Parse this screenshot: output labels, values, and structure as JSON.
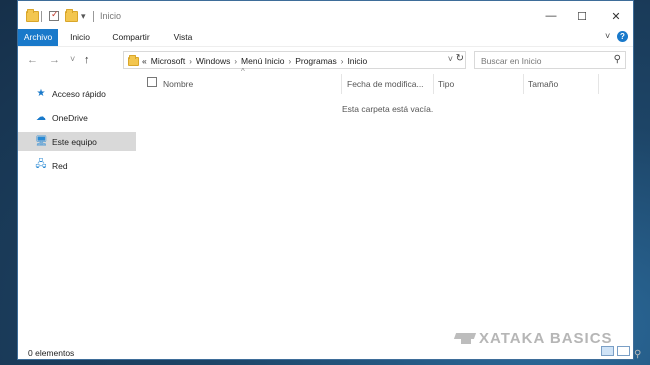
{
  "window": {
    "title": "Inicio",
    "minimize": "—",
    "maximize": "☐",
    "close": "✕"
  },
  "ribbon": {
    "tabs": [
      "Archivo",
      "Inicio",
      "Compartir",
      "Vista"
    ],
    "expand": "˅",
    "help": "?"
  },
  "address": {
    "overflow": "«",
    "crumbs": [
      "Microsoft",
      "Windows",
      "Menú Inicio",
      "Programas",
      "Inicio"
    ],
    "separator": "›",
    "dropdown": "˅",
    "refresh": "↻"
  },
  "search": {
    "placeholder": "Buscar en Inicio",
    "icon": "search-icon"
  },
  "nav_buttons": {
    "back": "←",
    "forward": "→",
    "recent": "˅",
    "up": "↑"
  },
  "navigation_pane": {
    "items": [
      {
        "label": "Acceso rápido",
        "icon": "star-icon",
        "glyph": "★",
        "color": "#1979ca"
      },
      {
        "label": "OneDrive",
        "icon": "cloud-icon",
        "glyph": "☁",
        "color": "#1979ca"
      },
      {
        "label": "Este equipo",
        "icon": "computer-icon",
        "glyph": "🖥",
        "color": "#2a8ad4",
        "selected": true
      },
      {
        "label": "Red",
        "icon": "network-icon",
        "glyph": "🖧",
        "color": "#2a8ad4"
      }
    ]
  },
  "columns": [
    "Nombre",
    "Fecha de modifica...",
    "Tipo",
    "Tamaño"
  ],
  "sort_indicator": "^",
  "empty_message": "Esta carpeta está vacía.",
  "status": {
    "count": "0 elementos"
  },
  "watermark": "XATAKA BASICS",
  "colors": {
    "accent": "#1979ca",
    "selection": "#d9d9d9",
    "desktop": "#1c3a56"
  }
}
